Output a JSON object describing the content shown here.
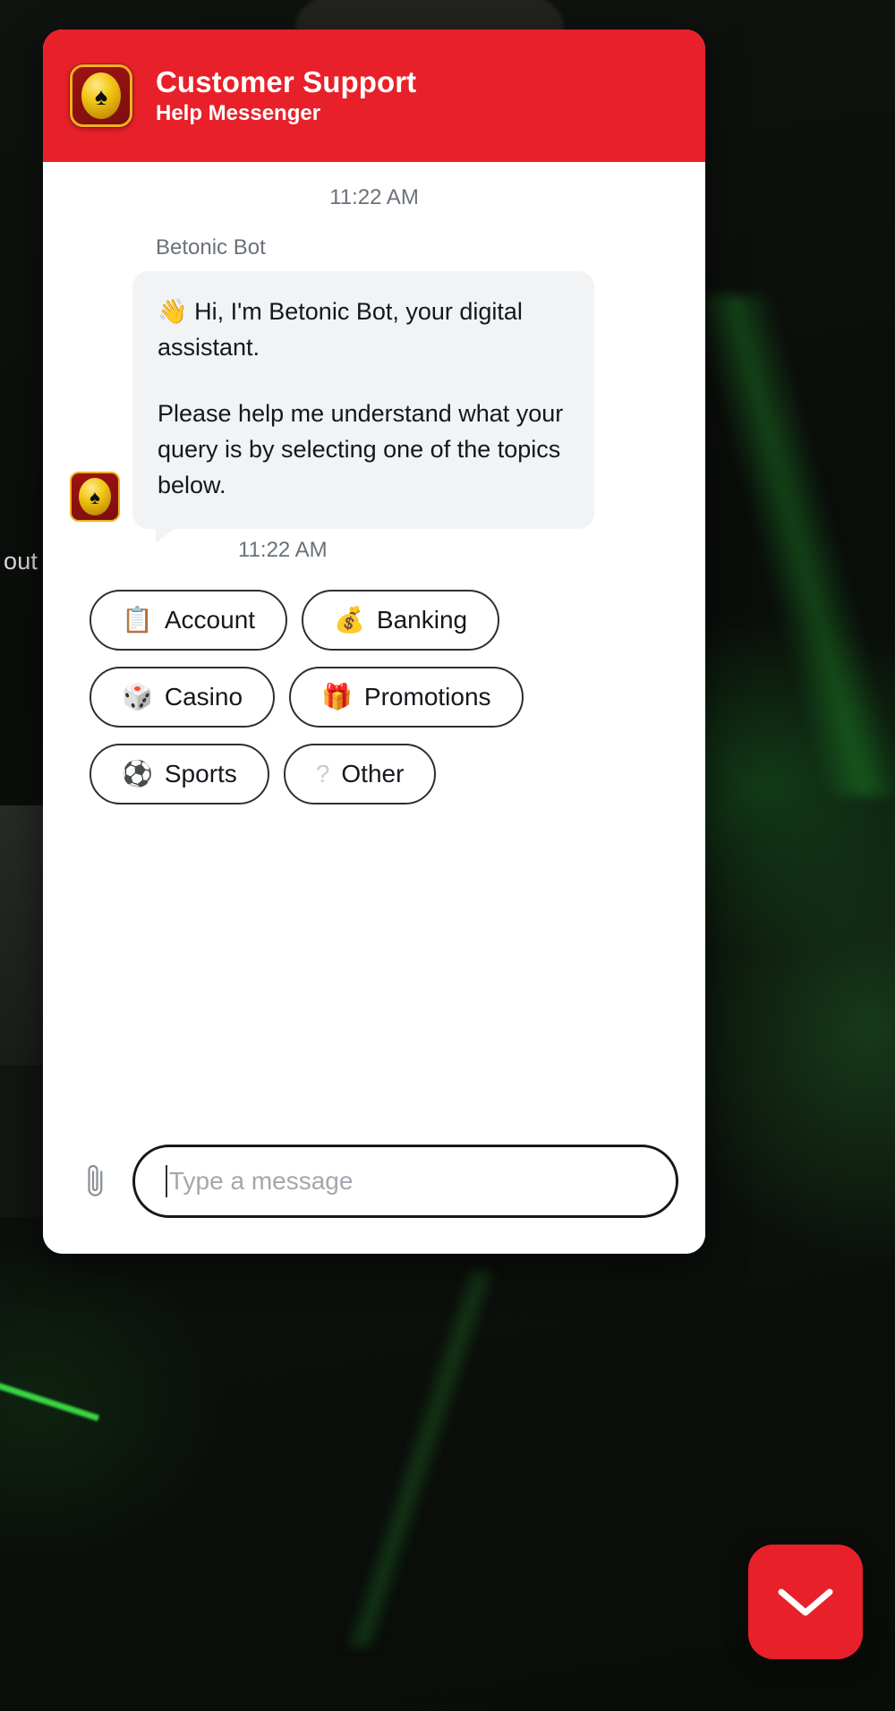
{
  "background": {
    "partial_text": "out",
    "page_bg_color": "#0a0d0a",
    "neon_accent_color": "#3ee84a"
  },
  "widget": {
    "header": {
      "title": "Customer Support",
      "subtitle": "Help Messenger",
      "brand_color": "#e8202a",
      "logo_icon": "spade-coin-logo-icon",
      "logo_glyph": "♠"
    },
    "conversation": {
      "day_time": "11:22 AM",
      "messages": [
        {
          "sender": "Betonic Bot",
          "avatar_icon": "bot-avatar-spade-icon",
          "avatar_glyph": "♠",
          "paragraphs": [
            "👋 Hi, I'm Betonic Bot, your digital assistant.",
            "Please help me understand what your query is by selecting one of the topics below."
          ],
          "time": "11:22 AM"
        }
      ]
    },
    "quick_replies": [
      {
        "icon": "clipboard-icon",
        "emoji": "📋",
        "label": "Account"
      },
      {
        "icon": "money-bag-icon",
        "emoji": "💰",
        "label": "Banking"
      },
      {
        "icon": "dice-icon",
        "emoji": "🎲",
        "label": "Casino"
      },
      {
        "icon": "gift-icon",
        "emoji": "🎁",
        "label": "Promotions"
      },
      {
        "icon": "soccer-ball-icon",
        "emoji": "⚽",
        "label": "Sports"
      },
      {
        "icon": "question-mark-icon",
        "emoji": "?",
        "label": "Other"
      }
    ],
    "composer": {
      "attach_icon": "paperclip-icon",
      "input_value": "",
      "input_placeholder": "Type a message"
    }
  },
  "collapse_button": {
    "icon": "chevron-down-icon",
    "color": "#e8202a"
  }
}
